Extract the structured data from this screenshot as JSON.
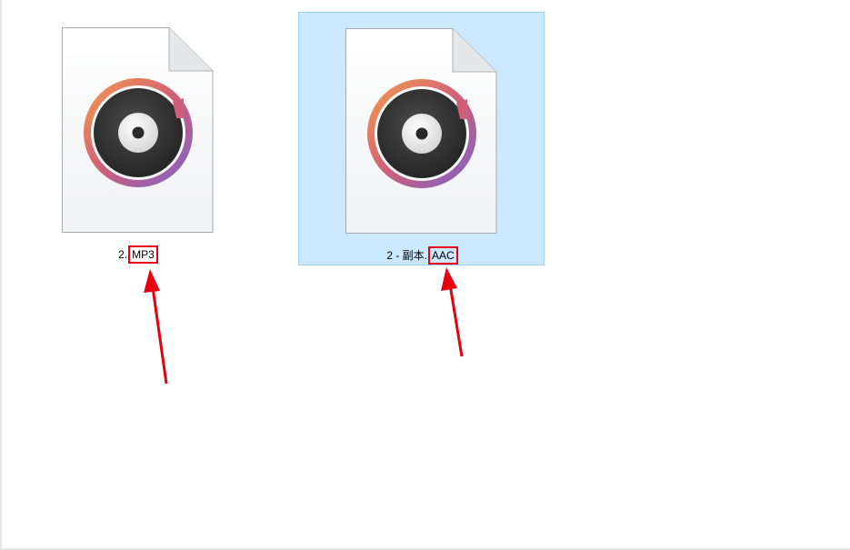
{
  "files": [
    {
      "name_prefix": "2.",
      "extension": "MP3",
      "selected": false
    },
    {
      "name_prefix": "2 - 副本.",
      "extension": "AAC",
      "selected": true
    }
  ],
  "icon": "music-disc-file-icon",
  "colors": {
    "selection_fill": "#cce8ff",
    "selection_border": "#99d1ff",
    "annotation_red": "#e60012",
    "disc_gradient": [
      "#f39a4f",
      "#c2588a",
      "#7e62c8"
    ]
  }
}
